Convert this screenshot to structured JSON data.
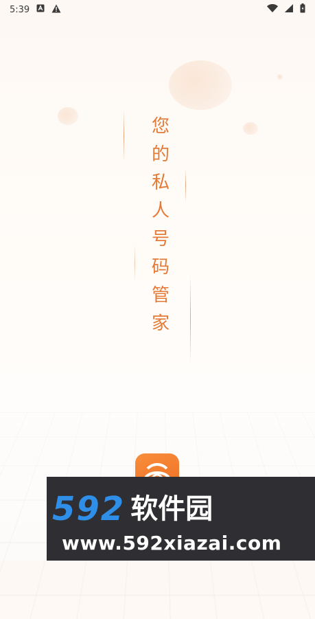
{
  "status_bar": {
    "time": "5:39",
    "left_icons": [
      "a-box-icon",
      "warning-icon"
    ],
    "right_icons": [
      "wifi-icon",
      "cell-signal-icon",
      "battery-icon"
    ]
  },
  "splash": {
    "slogan_chars": [
      "您",
      "的",
      "私",
      "人",
      "号",
      "码",
      "管",
      "家"
    ],
    "accent_color": "#e57a36"
  },
  "app_icon": {
    "name": "app-logo-icon"
  },
  "watermark": {
    "number": "592",
    "chinese": "软件园",
    "url": "www.592xiazai.com",
    "number_color": "#2f8fe8",
    "bg_color": "#2f2f33"
  }
}
